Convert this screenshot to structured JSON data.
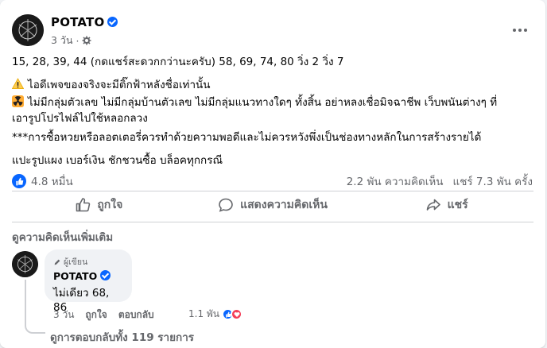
{
  "colors": {
    "brand": "#0866ff",
    "love": "#f33e58",
    "muted": "#65676b"
  },
  "post": {
    "author": "POTATO",
    "verified_icon": "verified-badge-icon",
    "time": "3 วัน",
    "privacy_icon": "gear-icon",
    "lines": {
      "l1": "15, 28, 39, 44 (กดแชร์สะดวกกว่านะครับ) 58, 69, 74, 80 วิ่ง 2 วิ่ง 7",
      "l2": "ไอดีเพจของจริงจะมีติ๊กฟ้าหลังชื่อเท่านั้น",
      "l3": "ไม่มีกลุ่มตัวเลข ไม่มีกลุ่มบ้านตัวเลข ไม่มีกลุ่มแนวทางใดๆ ทั้งสิ้น อย่าหลงเชื่อมิจฉาชีพ เว็บพนันต่างๆ ที่เอารูปโปรไฟล์ไปใช้หลอกลวง",
      "l4": "***การซื้อหวยหรือลอตเตอรี่ควรทำด้วยความพอดีและไม่ควรหวังพึ่งเป็นช่องทางหลักในการสร้างรายได้",
      "l5": "แปะรูปแผง เบอร์เงิน ชักชวนซื้อ บล็อคทุกกรณี"
    },
    "reactions": "4.8 หมื่น",
    "comments_count": "2.2 พัน ความคิดเห็น",
    "shares_count": "แชร์ 7.3 พัน ครั้ง"
  },
  "actions": {
    "like": "ถูกใจ",
    "comment": "แสดงความคิดเห็น",
    "share": "แชร์"
  },
  "more_comments": "ดูความคิดเห็นเพิ่มเติม",
  "comment": {
    "author_tag": "ผู้เขียน",
    "author": "POTATO",
    "text": "ไม่เดียว 68, 86",
    "time": "3 วัน",
    "like": "ถูกใจ",
    "reply": "ตอบกลับ",
    "reaction_count": "1.1 พัน"
  },
  "view_replies": "ดูการตอบกลับทั้ง 119 รายการ"
}
